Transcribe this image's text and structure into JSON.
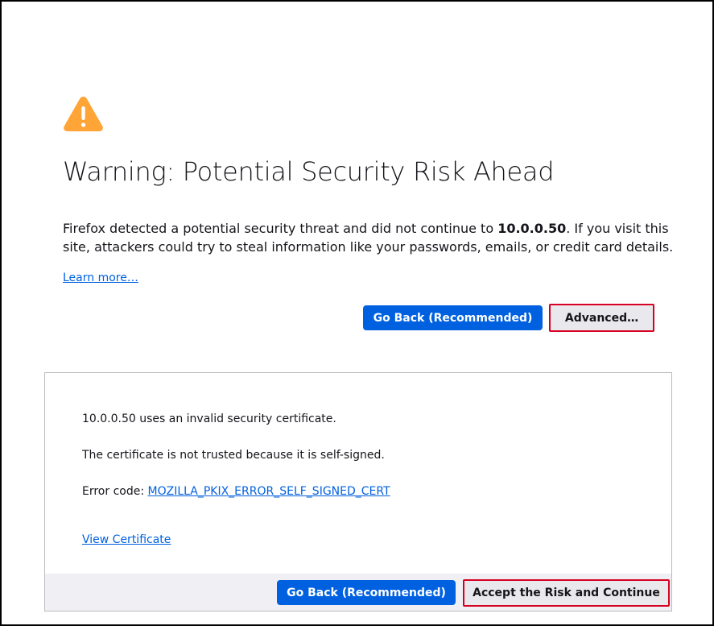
{
  "page": {
    "title": "Warning: Potential Security Risk Ahead",
    "description_pre": "Firefox detected a potential security threat and did not continue to ",
    "description_host": "10.0.0.50",
    "description_post": ". If you visit this site, attackers could try to steal information like your passwords, emails, or credit card details.",
    "learn_more": "Learn more…",
    "go_back_label": "Go Back (Recommended)",
    "advanced_label": "Advanced…",
    "warning_icon": "warning-triangle-icon",
    "accent_color": "#0061e0",
    "warning_color": "#ffa436"
  },
  "advanced_panel": {
    "invalid_cert_text": "10.0.0.50 uses an invalid security certificate.",
    "not_trusted_text": "The certificate is not trusted because it is self-signed.",
    "error_code_label": "Error code: ",
    "error_code": "MOZILLA_PKIX_ERROR_SELF_SIGNED_CERT",
    "view_certificate": "View Certificate",
    "go_back_label": "Go Back (Recommended)",
    "accept_label": "Accept the Risk and Continue"
  }
}
